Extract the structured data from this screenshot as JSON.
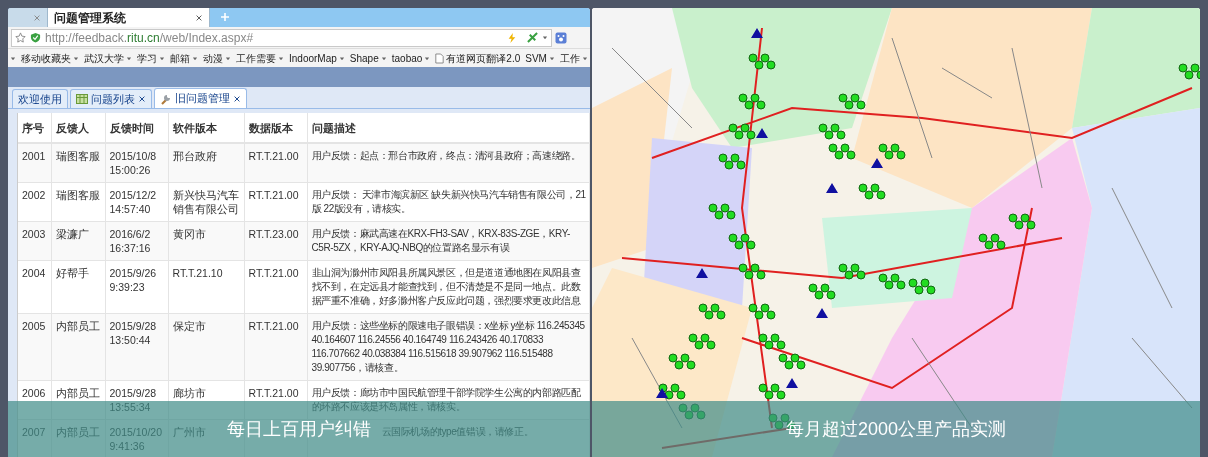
{
  "slides": [
    {
      "kind": "browser",
      "caption": "每日上百用户纠错",
      "browser": {
        "tabs": [
          {
            "selected": false
          },
          {
            "title": "问题管理系统",
            "selected": true
          }
        ],
        "url_parts": [
          "http://feedback.",
          "ritu.cn",
          "/web/Index.aspx#"
        ],
        "bookmarks": [
          {
            "label": "移动收藏夹",
            "dropdown": true
          },
          {
            "label": "武汉大学",
            "dropdown": true
          },
          {
            "label": "学习",
            "dropdown": true
          },
          {
            "label": "邮箱",
            "dropdown": true
          },
          {
            "label": "动漫",
            "dropdown": true
          },
          {
            "label": "工作需要",
            "dropdown": true
          },
          {
            "label": "IndoorMap",
            "dropdown": true
          },
          {
            "label": "Shape",
            "dropdown": true
          },
          {
            "label": "taobao",
            "dropdown": true
          },
          {
            "label": "有道网页翻译2.0",
            "dropdown": false
          },
          {
            "label": "SVM",
            "dropdown": true
          },
          {
            "label": "工作",
            "dropdown": true
          }
        ],
        "page_tabs": [
          {
            "label": "欢迎使用",
            "closable": false,
            "selected": false
          },
          {
            "label": "问题列表",
            "closable": true,
            "selected": false
          },
          {
            "label": "旧问题管理",
            "closable": true,
            "selected": true
          }
        ],
        "table": {
          "columns": [
            "序号",
            "反馈人",
            "反馈时间",
            "软件版本",
            "数据版本",
            "问题描述"
          ],
          "rows": [
            [
              "2001",
              "瑞图客服",
              "2015/10/8 15:00:26",
              "邢台政府",
              "RT.T.21.00",
              "用户反馈：起点：邢台市政府，终点：清河县政府；高速绕路。"
            ],
            [
              "2002",
              "瑞图客服",
              "2015/12/2 14:57:40",
              "新兴快马汽车销售有限公司",
              "RT.T.21.00",
              "用户反馈： 天津市海滨新区 缺失新兴快马汽车销售有限公司，21版 22版没有，请核实。"
            ],
            [
              "2003",
              "梁濂广",
              "2016/6/2 16:37:16",
              "黄冈市",
              "RT.T.23.00",
              "用户反馈：麻武高速在KRX-FH3-SAV，KRX-83S-ZGE，KRY-C5R-5ZX，KRY-AJQ-NBQ的位置路名显示有误"
            ],
            [
              "2004",
              "好帮手",
              "2015/9/26 9:39:23",
              "RT.T.21.10",
              "RT.T.21.00",
              "韭山洞为滁州市凤阳县所属风景区，但是道道通地图在凤阳县查找不到，在定远县才能查找到，但不清楚是不是同一地点。此数据严重不准确，好多滁州客户反应此问题，强烈要求更改此信息"
            ],
            [
              "2005",
              "内部员工",
              "2015/9/28 13:50:44",
              "保定市",
              "RT.T.21.00",
              "用户反馈：这些坐标的限速电子眼错误：x坐标 y坐标 116.245345 40.164607 116.24556 40.164749 116.243426 40.170833 116.707662 40.038384 116.515618 39.907962 116.515488 39.907756，请核查。"
            ],
            [
              "2006",
              "内部员工",
              "2015/9/28 13:55:34",
              "廊坊市",
              "RT.T.21.00",
              "用户反馈：廊坊市中国民航管理干部学院学生公寓的内部路匹配的环路不应该是环岛属性，请核实。"
            ],
            [
              "2007",
              "内部员工",
              "2015/10/20 9:41:36",
              "广州市",
              null,
              "云国际机场的type值错误，请修正。"
            ]
          ]
        }
      }
    },
    {
      "kind": "map",
      "caption": "每月超过2000公里产品实测"
    }
  ]
}
